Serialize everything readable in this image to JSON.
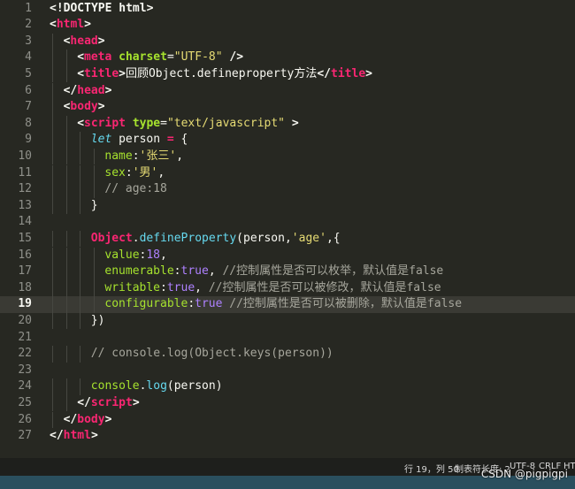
{
  "editor": {
    "current_line": 19,
    "lines": [
      {
        "n": "1",
        "indent": 0,
        "tokens": [
          {
            "c": "t-bracket",
            "t": "<!DOCTYPE html>"
          }
        ]
      },
      {
        "n": "2",
        "indent": 0,
        "tokens": [
          {
            "c": "t-bracket",
            "t": "<"
          },
          {
            "c": "t-tag",
            "t": "html"
          },
          {
            "c": "t-bracket",
            "t": ">"
          }
        ]
      },
      {
        "n": "3",
        "indent": 1,
        "tokens": [
          {
            "c": "t-bracket",
            "t": "<"
          },
          {
            "c": "t-tag",
            "t": "head"
          },
          {
            "c": "t-bracket",
            "t": ">"
          }
        ]
      },
      {
        "n": "4",
        "indent": 2,
        "tokens": [
          {
            "c": "t-bracket",
            "t": "<"
          },
          {
            "c": "t-tag",
            "t": "meta"
          },
          {
            "c": "t-text",
            "t": " "
          },
          {
            "c": "t-attr",
            "t": "charset"
          },
          {
            "c": "t-punc",
            "t": "="
          },
          {
            "c": "t-str",
            "t": "\"UTF-8\""
          },
          {
            "c": "t-text",
            "t": " "
          },
          {
            "c": "t-bracket",
            "t": "/>"
          }
        ]
      },
      {
        "n": "5",
        "indent": 2,
        "tokens": [
          {
            "c": "t-bracket",
            "t": "<"
          },
          {
            "c": "t-tag",
            "t": "title"
          },
          {
            "c": "t-bracket",
            "t": ">"
          },
          {
            "c": "t-text",
            "t": "回顾Object.defineproperty方法"
          },
          {
            "c": "t-bracket",
            "t": "</"
          },
          {
            "c": "t-tag",
            "t": "title"
          },
          {
            "c": "t-bracket",
            "t": ">"
          }
        ]
      },
      {
        "n": "6",
        "indent": 1,
        "tokens": [
          {
            "c": "t-bracket",
            "t": "</"
          },
          {
            "c": "t-tag",
            "t": "head"
          },
          {
            "c": "t-bracket",
            "t": ">"
          }
        ]
      },
      {
        "n": "7",
        "indent": 1,
        "tokens": [
          {
            "c": "t-bracket",
            "t": "<"
          },
          {
            "c": "t-tag",
            "t": "body"
          },
          {
            "c": "t-bracket",
            "t": ">"
          }
        ]
      },
      {
        "n": "8",
        "indent": 2,
        "tokens": [
          {
            "c": "t-bracket",
            "t": "<"
          },
          {
            "c": "t-tag",
            "t": "script"
          },
          {
            "c": "t-text",
            "t": " "
          },
          {
            "c": "t-attr",
            "t": "type"
          },
          {
            "c": "t-punc",
            "t": "="
          },
          {
            "c": "t-str",
            "t": "\"text/javascript\""
          },
          {
            "c": "t-text",
            "t": " "
          },
          {
            "c": "t-bracket",
            "t": ">"
          }
        ]
      },
      {
        "n": "9",
        "indent": 3,
        "tokens": [
          {
            "c": "t-kw",
            "t": "let"
          },
          {
            "c": "t-text",
            "t": " person "
          },
          {
            "c": "t-obj",
            "t": "="
          },
          {
            "c": "t-text",
            "t": " {"
          }
        ]
      },
      {
        "n": "10",
        "indent": 4,
        "tokens": [
          {
            "c": "t-prop",
            "t": "name"
          },
          {
            "c": "t-punc",
            "t": ":"
          },
          {
            "c": "t-str",
            "t": "'张三'"
          },
          {
            "c": "t-punc",
            "t": ","
          }
        ]
      },
      {
        "n": "11",
        "indent": 4,
        "tokens": [
          {
            "c": "t-prop",
            "t": "sex"
          },
          {
            "c": "t-punc",
            "t": ":"
          },
          {
            "c": "t-str",
            "t": "'男'"
          },
          {
            "c": "t-punc",
            "t": ","
          }
        ]
      },
      {
        "n": "12",
        "indent": 4,
        "tokens": [
          {
            "c": "t-cmt",
            "t": "// age:18"
          }
        ]
      },
      {
        "n": "13",
        "indent": 3,
        "tokens": [
          {
            "c": "t-punc",
            "t": "}"
          }
        ]
      },
      {
        "n": "14",
        "indent": 0,
        "tokens": []
      },
      {
        "n": "15",
        "indent": 3,
        "tokens": [
          {
            "c": "t-obj",
            "t": "Object"
          },
          {
            "c": "t-punc",
            "t": "."
          },
          {
            "c": "t-fn",
            "t": "defineProperty"
          },
          {
            "c": "t-punc",
            "t": "(person,"
          },
          {
            "c": "t-str",
            "t": "'age'"
          },
          {
            "c": "t-punc",
            "t": ",{"
          }
        ]
      },
      {
        "n": "16",
        "indent": 4,
        "tokens": [
          {
            "c": "t-prop",
            "t": "value"
          },
          {
            "c": "t-punc",
            "t": ":"
          },
          {
            "c": "t-num",
            "t": "18"
          },
          {
            "c": "t-punc",
            "t": ","
          }
        ]
      },
      {
        "n": "17",
        "indent": 4,
        "tokens": [
          {
            "c": "t-prop",
            "t": "enumerable"
          },
          {
            "c": "t-punc",
            "t": ":"
          },
          {
            "c": "t-bool",
            "t": "true"
          },
          {
            "c": "t-punc",
            "t": ", "
          },
          {
            "c": "t-cmt",
            "t": "//控制属性是否可以枚举，默认值是false"
          }
        ]
      },
      {
        "n": "18",
        "indent": 4,
        "tokens": [
          {
            "c": "t-prop",
            "t": "writable"
          },
          {
            "c": "t-punc",
            "t": ":"
          },
          {
            "c": "t-bool",
            "t": "true"
          },
          {
            "c": "t-punc",
            "t": ", "
          },
          {
            "c": "t-cmt",
            "t": "//控制属性是否可以被修改，默认值是false"
          }
        ]
      },
      {
        "n": "19",
        "indent": 4,
        "tokens": [
          {
            "c": "t-prop",
            "t": "configurable"
          },
          {
            "c": "t-punc",
            "t": ":"
          },
          {
            "c": "t-bool",
            "t": "true"
          },
          {
            "c": "t-text",
            "t": " "
          },
          {
            "c": "t-cmt",
            "t": "//控制属性是否可以被删除，默认值是false"
          }
        ]
      },
      {
        "n": "20",
        "indent": 3,
        "tokens": [
          {
            "c": "t-punc",
            "t": "})"
          }
        ]
      },
      {
        "n": "21",
        "indent": 0,
        "tokens": []
      },
      {
        "n": "22",
        "indent": 3,
        "tokens": [
          {
            "c": "t-cmt",
            "t": "// console.log(Object.keys(person))"
          }
        ]
      },
      {
        "n": "23",
        "indent": 0,
        "tokens": []
      },
      {
        "n": "24",
        "indent": 3,
        "tokens": [
          {
            "c": "t-prop",
            "t": "console"
          },
          {
            "c": "t-punc",
            "t": "."
          },
          {
            "c": "t-fn",
            "t": "log"
          },
          {
            "c": "t-punc",
            "t": "(person)"
          }
        ]
      },
      {
        "n": "25",
        "indent": 2,
        "tokens": [
          {
            "c": "t-bracket",
            "t": "</"
          },
          {
            "c": "t-tag",
            "t": "script"
          },
          {
            "c": "t-bracket",
            "t": ">"
          }
        ]
      },
      {
        "n": "26",
        "indent": 1,
        "tokens": [
          {
            "c": "t-bracket",
            "t": "</"
          },
          {
            "c": "t-tag",
            "t": "body"
          },
          {
            "c": "t-bracket",
            "t": ">"
          }
        ]
      },
      {
        "n": "27",
        "indent": 0,
        "tokens": [
          {
            "c": "t-bracket",
            "t": "</"
          },
          {
            "c": "t-tag",
            "t": "html"
          },
          {
            "c": "t-bracket",
            "t": ">"
          }
        ]
      }
    ]
  },
  "statusbar": {
    "position": "行 19，列 50",
    "tab_size": "制表符长度: 2",
    "encoding": "UTF-8",
    "line_ending": "CRLF",
    "syntax": "HTM"
  },
  "watermark": "CSDN @pigpigpi",
  "colors": {
    "background": "#272822",
    "current_line": "#3a3a34",
    "tag": "#f92672",
    "attribute": "#a6e22e",
    "string": "#e6db74",
    "keyword": "#66d9ef",
    "number": "#ae81ff",
    "comment": "#a6a69c",
    "statusbar": "#1e1f1c"
  }
}
